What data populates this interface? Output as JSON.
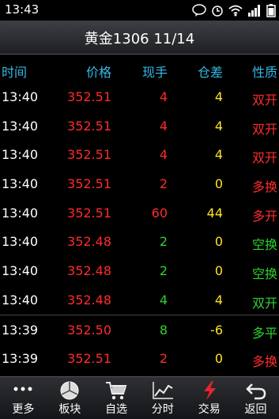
{
  "status": {
    "time": "13:43"
  },
  "title": "黄金1306  11/14",
  "columns": {
    "time": "时间",
    "price": "价格",
    "volume": "现手",
    "oi": "仓差",
    "nature": "性质"
  },
  "rows": [
    {
      "time": "13:40",
      "price": "352.51",
      "volume": "4",
      "oi": "4",
      "nature": "双开",
      "nature_color": "#ff2b2b",
      "vol_color": "#ff2b2b"
    },
    {
      "time": "13:40",
      "price": "352.51",
      "volume": "4",
      "oi": "4",
      "nature": "双开",
      "nature_color": "#ff2b2b",
      "vol_color": "#ff2b2b"
    },
    {
      "time": "13:40",
      "price": "352.51",
      "volume": "4",
      "oi": "4",
      "nature": "双开",
      "nature_color": "#ff2b2b",
      "vol_color": "#ff2b2b"
    },
    {
      "time": "13:40",
      "price": "352.51",
      "volume": "2",
      "oi": "0",
      "nature": "多换",
      "nature_color": "#ff2b2b",
      "vol_color": "#ff2b2b"
    },
    {
      "time": "13:40",
      "price": "352.51",
      "volume": "60",
      "oi": "44",
      "nature": "多开",
      "nature_color": "#ff2b2b",
      "vol_color": "#ff2b2b"
    },
    {
      "time": "13:40",
      "price": "352.48",
      "volume": "2",
      "oi": "0",
      "nature": "空换",
      "nature_color": "#2fd12f",
      "vol_color": "#2fd12f"
    },
    {
      "time": "13:40",
      "price": "352.48",
      "volume": "2",
      "oi": "0",
      "nature": "空换",
      "nature_color": "#2fd12f",
      "vol_color": "#2fd12f"
    },
    {
      "time": "13:40",
      "price": "352.48",
      "volume": "4",
      "oi": "4",
      "nature": "双开",
      "nature_color": "#2fd12f",
      "vol_color": "#2fd12f"
    },
    {
      "time": "13:39",
      "price": "352.50",
      "volume": "8",
      "oi": "-6",
      "nature": "多平",
      "nature_color": "#2fd12f",
      "vol_color": "#2fd12f"
    },
    {
      "time": "13:39",
      "price": "352.51",
      "volume": "2",
      "oi": "0",
      "nature": "多换",
      "nature_color": "#ff2b2b",
      "vol_color": "#ff2b2b"
    }
  ],
  "toolbar": [
    {
      "label": "更多",
      "icon": "more-icon"
    },
    {
      "label": "板块",
      "icon": "sector-icon"
    },
    {
      "label": "自选",
      "icon": "cart-icon"
    },
    {
      "label": "分时",
      "icon": "chart-icon"
    },
    {
      "label": "交易",
      "icon": "lightning-icon"
    },
    {
      "label": "返回",
      "icon": "back-icon"
    }
  ]
}
